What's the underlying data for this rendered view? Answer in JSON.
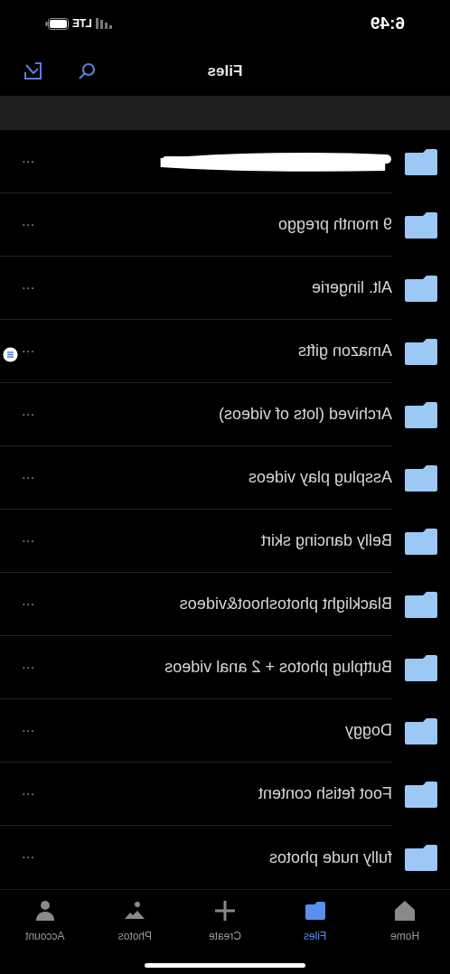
{
  "status_bar": {
    "time": "6:49",
    "network": "LTE"
  },
  "header": {
    "title": "Files"
  },
  "folders": [
    {
      "kind": "redacted"
    },
    {
      "kind": "folder",
      "name": "9 month preggo"
    },
    {
      "kind": "folder",
      "name": "Alt. lingerie"
    },
    {
      "kind": "folder",
      "name": "Amazon gifts"
    },
    {
      "kind": "folder",
      "name": "Archived (lots of videos)"
    },
    {
      "kind": "folder",
      "name": "Assplug play videos"
    },
    {
      "kind": "folder",
      "name": "Belly dancing skirt"
    },
    {
      "kind": "folder",
      "name": "Blacklight photoshoot&videos"
    },
    {
      "kind": "folder",
      "name": "Buttplug photos + 2 anal videos"
    },
    {
      "kind": "folder",
      "name": "Doggy"
    },
    {
      "kind": "folder",
      "name": "Foot fetish content"
    },
    {
      "kind": "folder",
      "name": "fully nude photos"
    }
  ],
  "more_label": "···",
  "tabs": [
    {
      "kind": "account",
      "label": "Account",
      "selected": false
    },
    {
      "kind": "photos",
      "label": "Photos",
      "selected": false
    },
    {
      "kind": "create",
      "label": "Create",
      "selected": false
    },
    {
      "kind": "files",
      "label": "Files",
      "selected": true
    },
    {
      "kind": "home",
      "label": "Home",
      "selected": false
    }
  ]
}
